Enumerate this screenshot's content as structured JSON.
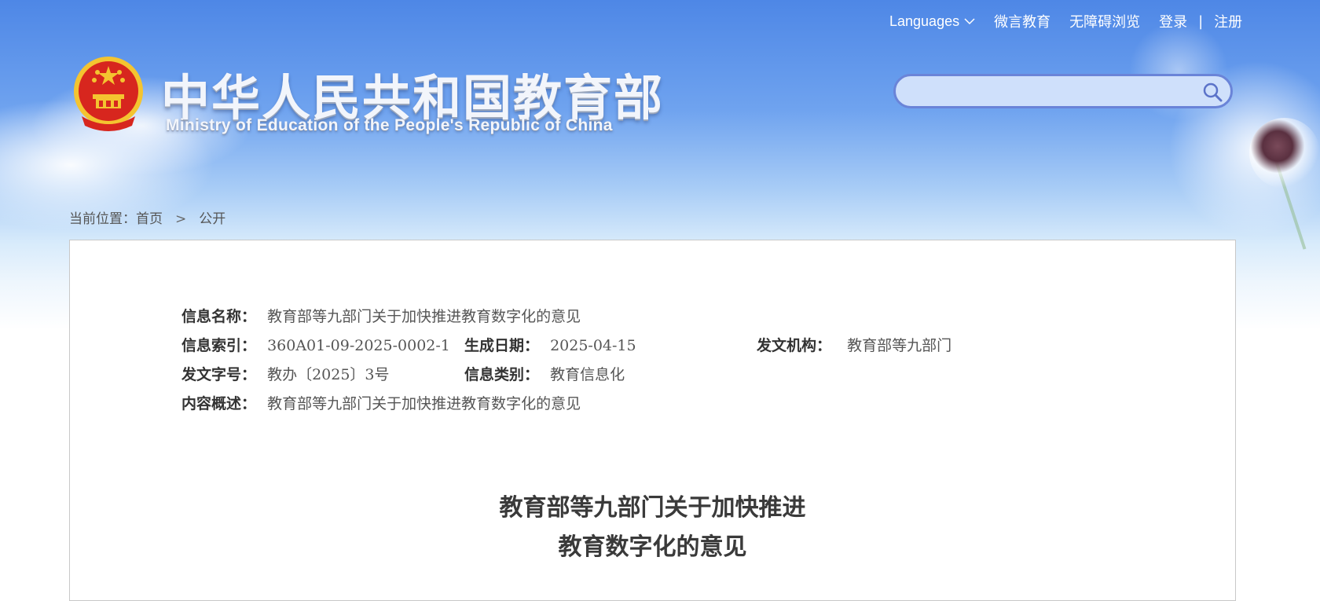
{
  "topnav": {
    "languages": "Languages",
    "weiyan": "微言教育",
    "accessibility": "无障碍浏览",
    "login": "登录",
    "divider": "|",
    "register": "注册"
  },
  "header": {
    "title_cn": "中华人民共和国教育部",
    "title_en": "Ministry of Education of the People's Republic of China"
  },
  "search": {
    "value": "",
    "placeholder": ""
  },
  "breadcrumb": {
    "prefix": "当前位置：",
    "home": "首页",
    "separator": ">",
    "current": "公开"
  },
  "info": {
    "name_label": "信息名称：",
    "name_value": "教育部等九部门关于加快推进教育数字化的意见",
    "index_label": "信息索引：",
    "index_value": "360A01-09-2025-0002-1",
    "date_label": "生成日期：",
    "date_value": "2025-04-15",
    "issuer_label": "发文机构：",
    "issuer_value": "教育部等九部门",
    "docno_label": "发文字号：",
    "docno_value": "教办〔2025〕3号",
    "category_label": "信息类别：",
    "category_value": "教育信息化",
    "summary_label": "内容概述：",
    "summary_value": "教育部等九部门关于加快推进教育数字化的意见"
  },
  "document": {
    "title_line1": "教育部等九部门关于加快推进",
    "title_line2": "教育数字化的意见"
  },
  "colors": {
    "header_blue": "#4e87e6",
    "search_border": "#6a84d8",
    "emblem_red": "#d7261e",
    "emblem_gold": "#f4c430"
  }
}
